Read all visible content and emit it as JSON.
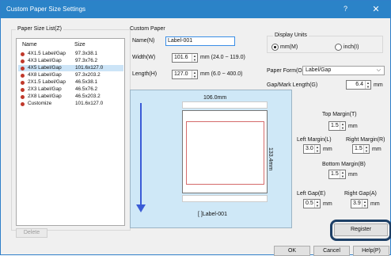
{
  "window": {
    "title": "Custom Paper Size Settings",
    "help_icon": "?",
    "close_icon": "✕"
  },
  "paper_size_list": {
    "group_label": "Paper Size List(Z)",
    "col_name": "Name",
    "col_size": "Size",
    "items": [
      {
        "name": "4X1.5 Label/Gap",
        "size": "97.3x38.1",
        "selected": false
      },
      {
        "name": "4X3 Label/Gap",
        "size": "97.3x76.2",
        "selected": false
      },
      {
        "name": "4X5 Label/Gap",
        "size": "101.6x127.0",
        "selected": true
      },
      {
        "name": "4X8 Label/Gap",
        "size": "97.3x203.2",
        "selected": false
      },
      {
        "name": "2X1.5 Label/Gap",
        "size": "46.5x38.1",
        "selected": false
      },
      {
        "name": "2X3 Label/Gap",
        "size": "46.5x76.2",
        "selected": false
      },
      {
        "name": "2X8 Label/Gap",
        "size": "46.5x203.2",
        "selected": false
      },
      {
        "name": "Customize",
        "size": "101.6x127.0",
        "selected": false
      }
    ],
    "item_icon": "red-circle-icon"
  },
  "custom_paper": {
    "group_label": "Custom Paper",
    "name_label": "Name(N)",
    "name_value": "Label-001",
    "width_label": "Width(W)",
    "width_value": "101.6",
    "width_range": "mm (24.0 ~ 119.0)",
    "length_label": "Length(H)",
    "length_value": "127.0",
    "length_range": "mm (6.0 ~ 400.0)"
  },
  "display_units": {
    "group_label": "Display Units",
    "mm_label": "mm(M)",
    "inch_label": "inch(I)",
    "selected": "mm"
  },
  "paper_form": {
    "label": "Paper Form(O)",
    "value": "Label/Gap"
  },
  "gap_mark": {
    "label": "Gap/Mark Length(G)",
    "value": "6.4",
    "unit": "mm"
  },
  "preview": {
    "width_text": "106.0mm",
    "height_text": "133.4mm",
    "caption": "[ ]Label-001"
  },
  "margins": {
    "top_label": "Top Margin(T)",
    "top_value": "1.5",
    "left_label": "Left Margin(L)",
    "left_value": "3.0",
    "right_label": "Right Margin(R)",
    "right_value": "1.5",
    "bottom_label": "Bottom Margin(B)",
    "bottom_value": "1.5",
    "unit": "mm"
  },
  "gaps": {
    "left_label": "Left Gap(E)",
    "left_value": "0.5",
    "right_label": "Right Gap(A)",
    "right_value": "3.9",
    "unit": "mm"
  },
  "buttons": {
    "delete": "Delete",
    "register": "Register",
    "ok": "OK",
    "cancel": "Cancel",
    "help": "Help(P)"
  },
  "spin_up": "▲",
  "spin_down": "▼",
  "dropdown_icon": "⌵"
}
